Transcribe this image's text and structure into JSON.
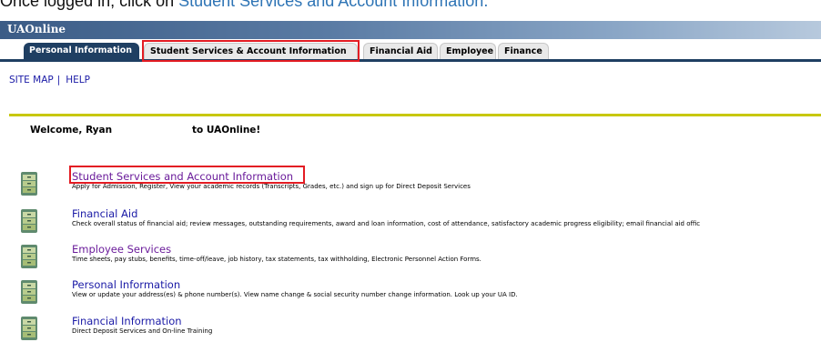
{
  "instruction": {
    "prefix": "Once logged in, click on ",
    "highlight": "Student Services and Account Information."
  },
  "banner": {
    "title": "UAOnline"
  },
  "tabs": [
    {
      "label": "Personal Information",
      "active": true
    },
    {
      "label": "Student Services & Account Information",
      "active": false,
      "highlighted": true
    },
    {
      "label": "Financial Aid",
      "active": false
    },
    {
      "label": "Employee",
      "active": false
    },
    {
      "label": "Finance",
      "active": false
    }
  ],
  "toplinks": {
    "site_map": "SITE MAP",
    "separator": "|",
    "help": "HELP"
  },
  "welcome": {
    "greeting": "Welcome, Ryan",
    "suffix": "to UAOnline!"
  },
  "menu": [
    {
      "title": "Student Services and Account Information",
      "description": "Apply for Admission, Register, View your academic records (Transcripts, Grades, etc.) and sign up for Direct Deposit Services",
      "visited": true,
      "highlighted": true
    },
    {
      "title": "Financial Aid",
      "description": "Check overall status of financial aid; review messages, outstanding requirements, award and loan information, cost of attendance, satisfactory academic progress eligibility; email financial aid offic",
      "visited": false
    },
    {
      "title": "Employee Services",
      "description": "Time sheets, pay stubs, benefits, time-off/leave, job history, tax statements, tax withholding, Electronic Personnel Action Forms.",
      "visited": true
    },
    {
      "title": "Personal Information",
      "description": "View or update your address(es) & phone number(s). View name change & social security number change information. Look up your UA ID.",
      "visited": false
    },
    {
      "title": "Financial Information",
      "description": "Direct Deposit Services and On-line Training",
      "visited": false
    }
  ],
  "colors": {
    "highlight_box": "#e31c23",
    "banner": "#3b5c86",
    "tab_active": "#1f3f62",
    "rule": "#c8c80c",
    "link": "#1a1aa6",
    "visited": "#6a1b9a"
  },
  "icons": {
    "menu_item": "file-cabinet-icon"
  }
}
